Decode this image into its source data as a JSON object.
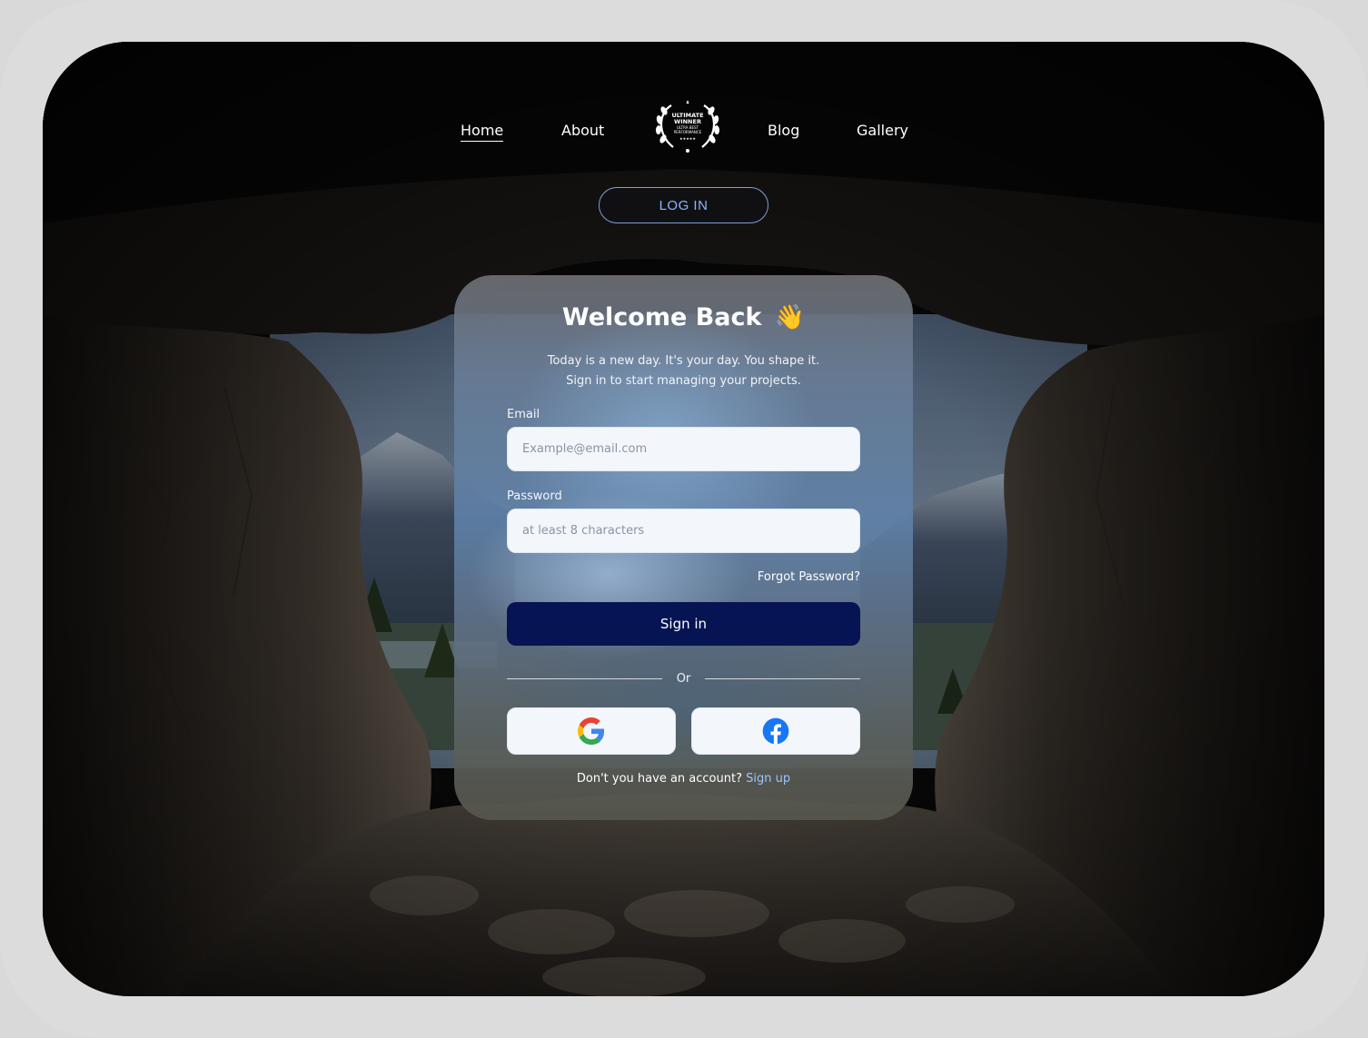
{
  "nav": {
    "links": [
      "Home",
      "About",
      "Blog",
      "Gallery"
    ],
    "active": "Home",
    "badge": {
      "line1": "ULTIMATE",
      "line2": "WINNER",
      "line3": "ULTRA BEST",
      "line4": "PERFORMANCE"
    }
  },
  "header": {
    "login_label": "LOG IN"
  },
  "card": {
    "title": "Welcome Back",
    "title_emoji": "👋",
    "subtitle_line1": "Today is a new day. It's your day. You shape it.",
    "subtitle_line2": "Sign in to start managing your projects.",
    "email_label": "Email",
    "email_placeholder": "Example@email.com",
    "password_label": "Password",
    "password_placeholder": "at least 8 characters",
    "forgot_label": "Forgot Password?",
    "signin_label": "Sign in",
    "divider_label": "Or",
    "signup_prompt": "Don't you have an account?",
    "signup_label": "Sign up",
    "social": [
      "google-icon",
      "facebook-icon"
    ]
  },
  "colors": {
    "signin_bg": "#061453",
    "login_accent": "#8fb4ff",
    "signup_link": "#9cc4ff",
    "facebook": "#1877f2"
  }
}
